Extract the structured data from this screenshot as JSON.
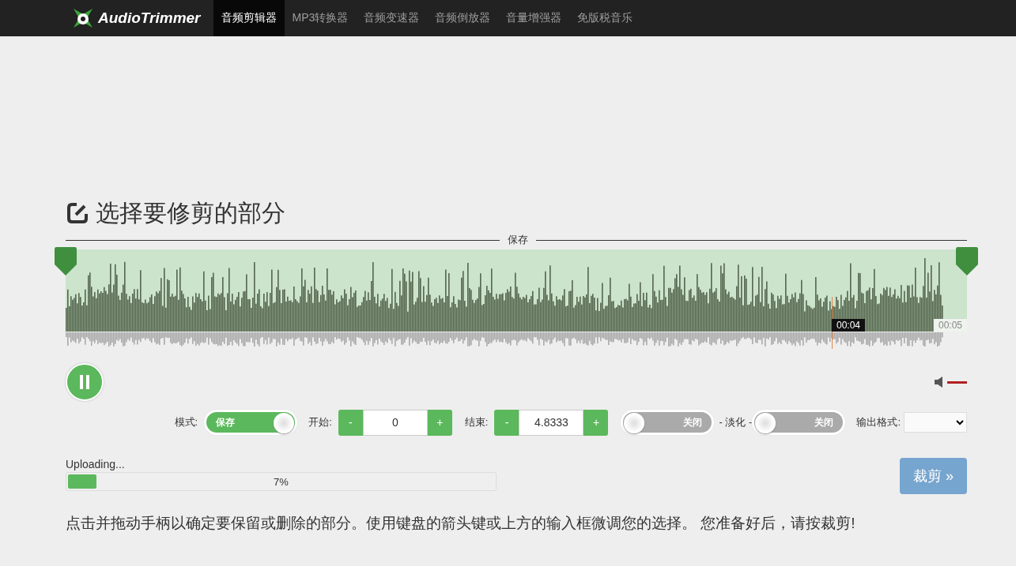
{
  "nav": {
    "logo": "AudioTrimmer",
    "items": [
      {
        "label": "音频剪辑器",
        "selected": true
      },
      {
        "label": "MP3转换器",
        "selected": false
      },
      {
        "label": "音频变速器",
        "selected": false
      },
      {
        "label": "音频倒放器",
        "selected": false
      },
      {
        "label": "音量增强器",
        "selected": false
      },
      {
        "label": "免版税音乐",
        "selected": false
      }
    ]
  },
  "heading": "选择要修剪的部分",
  "region_label": "保存",
  "waveform": {
    "playhead": {
      "time": "00:04",
      "level": 0.85
    },
    "duration": "00:05"
  },
  "player": {
    "playing": true,
    "volume": {
      "level": 1
    }
  },
  "controls": {
    "mode": {
      "label": "模式:",
      "value": "保存",
      "on": true
    },
    "start": {
      "label": "开始:",
      "minus": "-",
      "value": "0",
      "plus": "+"
    },
    "end": {
      "label": "结束:",
      "minus": "-",
      "value": "4.8333",
      "plus": "+"
    },
    "fade_in": {
      "value": "关闭",
      "on": false
    },
    "fade_label": "- 淡化 -",
    "fade_out": {
      "value": "关闭",
      "on": false
    },
    "format_label": "输出格式:"
  },
  "upload": {
    "status": "Uploading...",
    "level": 0.07,
    "percent": "7%"
  },
  "trim_button": "裁剪 »",
  "instructions": "点击并拖动手柄以确定要保留或删除的部分。使用键盘的箭头键或上方的输入框微调您的选择。 您准备好后，请按裁剪!"
}
